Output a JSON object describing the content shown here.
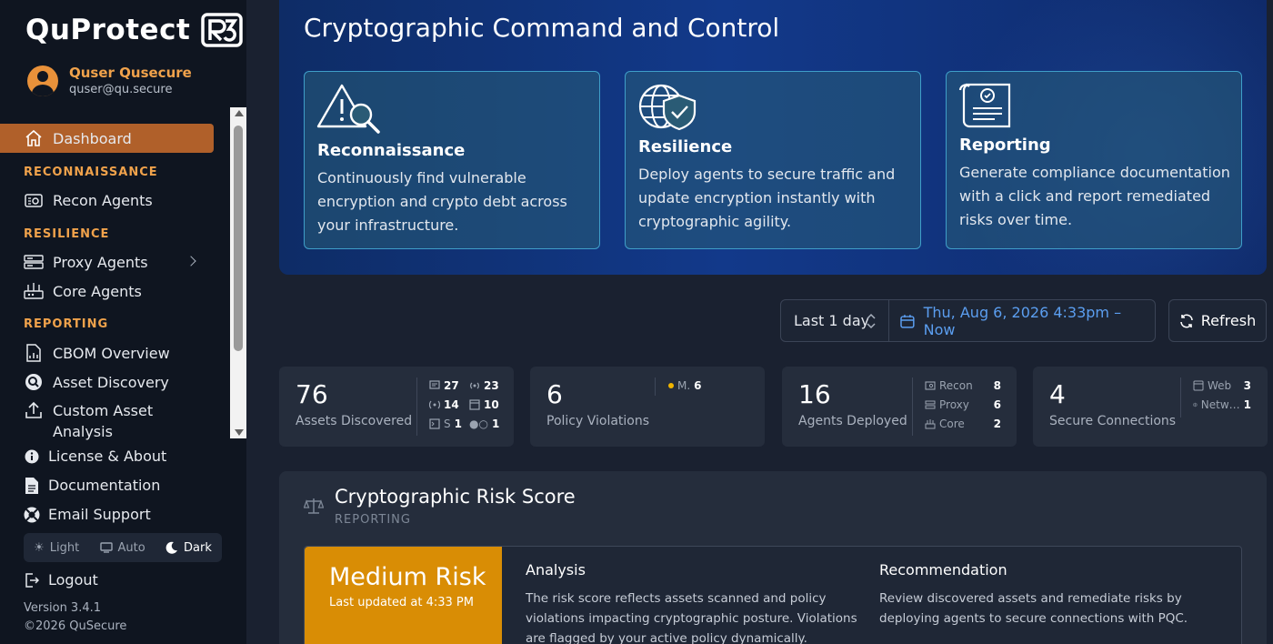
{
  "app": {
    "brand": "QuProtect",
    "logo_mark": "R3",
    "user": {
      "name": "Quser Qusecure",
      "email": "quser@qu.secure"
    }
  },
  "sidebar": {
    "dashboard": "Dashboard",
    "sections": {
      "reconnaissance": "RECONNAISSANCE",
      "resilience": "RESILIENCE",
      "reporting": "REPORTING"
    },
    "items": {
      "recon_agents": "Recon Agents",
      "proxy_agents": "Proxy Agents",
      "core_agents": "Core Agents",
      "cbom_overview": "CBOM Overview",
      "asset_discovery": "Asset Discovery",
      "custom_asset_analysis_line1": "Custom Asset",
      "custom_asset_analysis_line2": "Analysis"
    },
    "lower": {
      "license": "License & About",
      "documentation": "Documentation",
      "email_support": "Email Support",
      "logout": "Logout"
    },
    "theme": {
      "light": "Light",
      "auto": "Auto",
      "dark": "Dark",
      "selected": "Dark"
    },
    "version": "Version 3.4.1",
    "copyright": "©2026 QuSecure"
  },
  "hero": {
    "title": "Cryptographic Command and Control",
    "cards": [
      {
        "icon": "warning-search-icon",
        "title": "Reconnaissance",
        "text": "Continuously find vulnerable encryption and crypto debt across your infrastructure."
      },
      {
        "icon": "globe-shield-icon",
        "title": "Resilience",
        "text": "Deploy agents to secure traffic and update encryption instantly with cryptographic agility."
      },
      {
        "icon": "certificate-icon",
        "title": "Reporting",
        "text": "Generate compliance documentation with a click and report remediated risks over time."
      }
    ]
  },
  "controls": {
    "range": "Last 1 day",
    "date": "Thu, Aug 6, 2026 4:33pm – Now",
    "refresh": "Refresh"
  },
  "stats": {
    "assets": {
      "value": "76",
      "label": "Assets Discovered",
      "mini": [
        {
          "icon": "certificate-icon",
          "value": "27"
        },
        {
          "icon": "signal-icon",
          "value": "23"
        },
        {
          "icon": "broadcast-icon",
          "value": "14"
        },
        {
          "icon": "window-icon",
          "value": "10"
        },
        {
          "icon": "terminal-icon",
          "label": "S",
          "value": "1"
        },
        {
          "icon": "dots-icon",
          "label": "●○",
          "value": "1"
        }
      ]
    },
    "violations": {
      "value": "6",
      "label": "Policy Violations",
      "mini_label": "M.",
      "mini_value": "6",
      "mini_color": "#f0b400"
    },
    "agents": {
      "value": "16",
      "label": "Agents Deployed",
      "mini": [
        {
          "icon": "recon-icon",
          "label": "Recon",
          "value": "8"
        },
        {
          "icon": "proxy-icon",
          "label": "Proxy",
          "value": "6"
        },
        {
          "icon": "core-icon",
          "label": "Core",
          "value": "2"
        }
      ]
    },
    "connections": {
      "value": "4",
      "label": "Secure Connections",
      "mini": [
        {
          "icon": "web-icon",
          "label": "Web",
          "value": "3"
        },
        {
          "icon": "network-icon",
          "label": "Netw…",
          "value": "1"
        }
      ]
    }
  },
  "risk": {
    "title": "Cryptographic Risk Score",
    "subtitle": "REPORTING",
    "level": "Medium Risk",
    "updated": "Last updated at 4:33 PM",
    "level_color": "#d98d05",
    "analysis_head": "Analysis",
    "analysis_text": "The risk score reflects assets scanned and policy violations impacting cryptographic posture. Violations are flagged by your active policy dynamically.",
    "recommendation_head": "Recommendation",
    "recommendation_text": "Review discovered assets and remediate risks by deploying agents to secure connections with PQC."
  }
}
